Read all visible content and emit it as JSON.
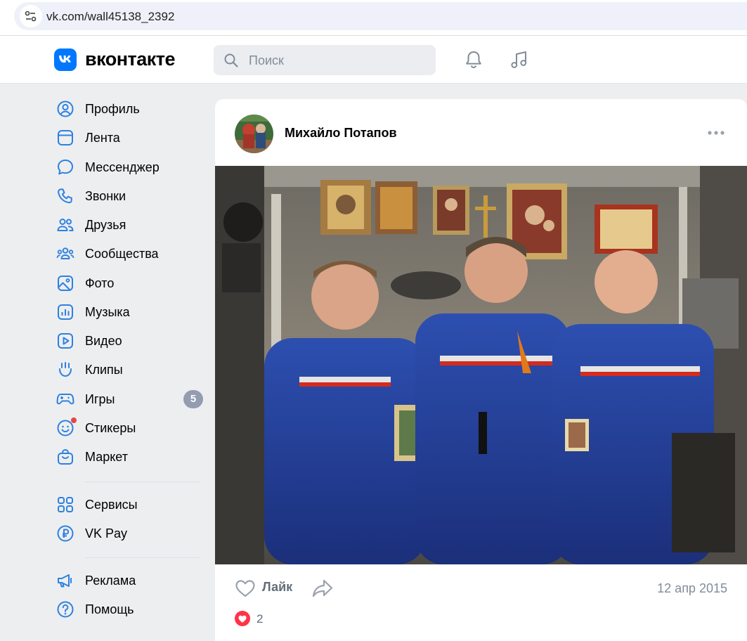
{
  "browser": {
    "url": "vk.com/wall45138_2392"
  },
  "header": {
    "logo_text": "вконтакте",
    "search_placeholder": "Поиск"
  },
  "sidebar": {
    "items": [
      {
        "label": "Профиль",
        "icon": "profile-icon"
      },
      {
        "label": "Лента",
        "icon": "feed-icon"
      },
      {
        "label": "Мессенджер",
        "icon": "messenger-icon"
      },
      {
        "label": "Звонки",
        "icon": "phone-icon"
      },
      {
        "label": "Друзья",
        "icon": "friends-icon"
      },
      {
        "label": "Сообщества",
        "icon": "communities-icon"
      },
      {
        "label": "Фото",
        "icon": "photo-icon"
      },
      {
        "label": "Музыка",
        "icon": "music-icon"
      },
      {
        "label": "Видео",
        "icon": "video-icon"
      },
      {
        "label": "Клипы",
        "icon": "clips-icon"
      },
      {
        "label": "Игры",
        "icon": "games-icon",
        "badge": "5"
      },
      {
        "label": "Стикеры",
        "icon": "stickers-icon"
      },
      {
        "label": "Маркет",
        "icon": "market-icon"
      }
    ],
    "items2": [
      {
        "label": "Сервисы",
        "icon": "services-icon"
      },
      {
        "label": "VK Pay",
        "icon": "vkpay-icon"
      }
    ],
    "items3": [
      {
        "label": "Реклама",
        "icon": "ads-icon"
      },
      {
        "label": "Помощь",
        "icon": "help-icon"
      }
    ]
  },
  "post": {
    "author": "Михайло Потапов",
    "like_label": "Лайк",
    "date": "12 апр 2015",
    "reaction_count": "2"
  },
  "colors": {
    "accent": "#0077ff",
    "background": "#edeef0",
    "icon": "#2d81e0"
  }
}
